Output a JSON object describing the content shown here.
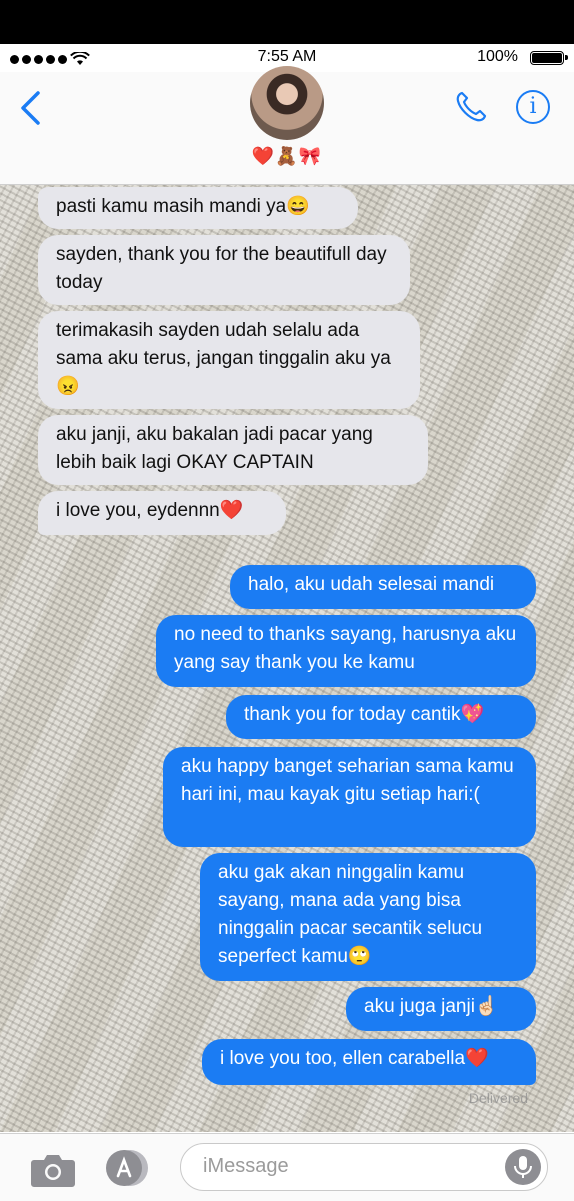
{
  "status_bar": {
    "time": "7:55 AM",
    "battery": "100%"
  },
  "header": {
    "contact_name": "❤️🧸🎀"
  },
  "messages": [
    {
      "side": "in",
      "text": "pasti kamu masih mandi ya😄"
    },
    {
      "side": "in",
      "text": "sayden, thank you for the beautifull day today"
    },
    {
      "side": "in",
      "text": "terimakasih sayden udah selalu ada sama aku terus, jangan tinggalin aku ya😠"
    },
    {
      "side": "in",
      "text": "aku janji, aku bakalan jadi pacar yang lebih baik lagi OKAY CAPTAIN"
    },
    {
      "side": "in",
      "text": "i love you, eydennn❤️"
    },
    {
      "side": "out",
      "text": "halo, aku udah selesai mandi"
    },
    {
      "side": "out",
      "text": "no need to thanks sayang, harusnya aku yang say thank you ke kamu"
    },
    {
      "side": "out",
      "text": "thank you for today cantik💖"
    },
    {
      "side": "out",
      "text": "aku happy banget seharian sama kamu hari ini, mau kayak gitu setiap hari:("
    },
    {
      "side": "out",
      "text": "aku gak akan ninggalin kamu sayang, mana ada yang bisa ninggalin pacar secantik selucu seperfect kamu🙄"
    },
    {
      "side": "out",
      "text": "aku juga janji☝🏻"
    },
    {
      "side": "out",
      "text": "i love you too, ellen carabella❤️"
    }
  ],
  "delivered_label": "Delivered",
  "input": {
    "placeholder": "iMessage"
  }
}
